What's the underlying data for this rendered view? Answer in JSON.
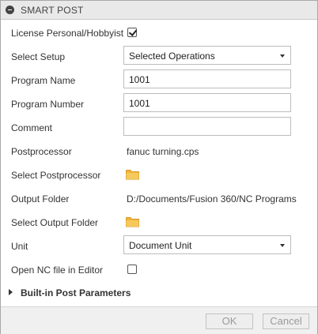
{
  "panel": {
    "title": "SMART POST"
  },
  "rows": {
    "license": {
      "label": "License Personal/Hobbyist",
      "checked": true
    },
    "select_setup": {
      "label": "Select Setup",
      "value": "Selected Operations"
    },
    "program_name": {
      "label": "Program Name",
      "value": "1001"
    },
    "program_number": {
      "label": "Program Number",
      "value": "1001"
    },
    "comment": {
      "label": "Comment",
      "value": ""
    },
    "postprocessor": {
      "label": "Postprocessor",
      "value": "fanuc turning.cps"
    },
    "select_postprocessor": {
      "label": "Select Postprocessor",
      "icon": "folder-icon"
    },
    "output_folder": {
      "label": "Output Folder",
      "value": "D:/Documents/Fusion 360/NC Programs"
    },
    "select_output_folder": {
      "label": "Select Output Folder",
      "icon": "folder-icon"
    },
    "unit": {
      "label": "Unit",
      "value": "Document Unit"
    },
    "open_nc": {
      "label": "Open NC file in Editor",
      "checked": false
    }
  },
  "section": {
    "title": "Built-in Post Parameters",
    "expanded": false
  },
  "buttons": {
    "ok": "OK",
    "cancel": "Cancel"
  },
  "colors": {
    "folder": "#f2b43c",
    "titlebar": "#e9e9e9",
    "footer": "#f0f0f0"
  }
}
